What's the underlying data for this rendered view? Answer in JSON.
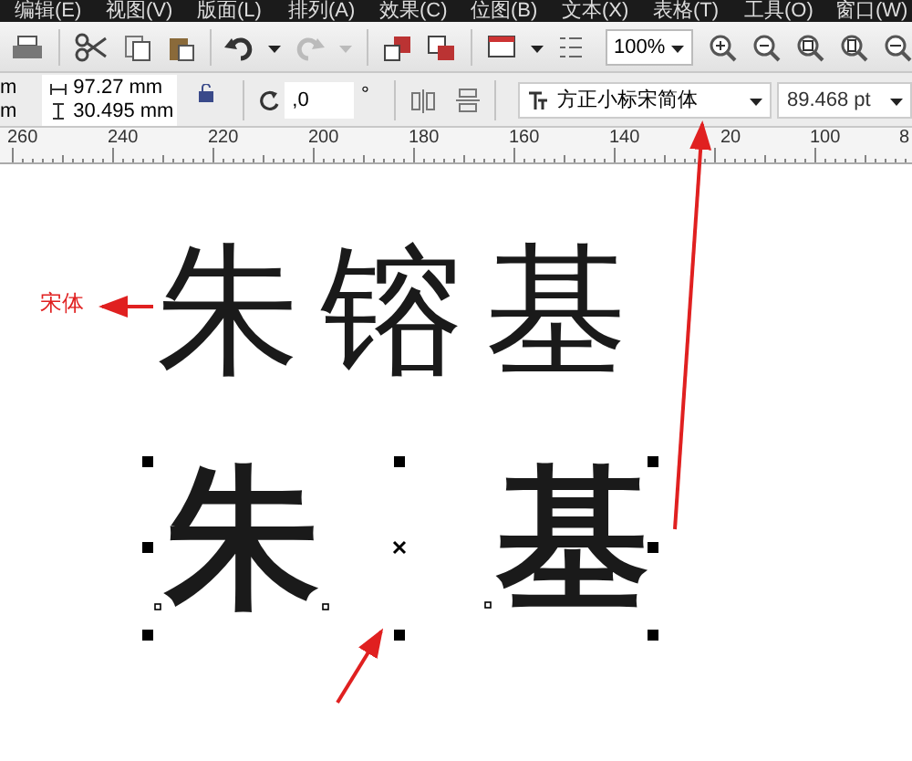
{
  "menu_bar": {
    "items": [
      "编辑(E)",
      "视图(V)",
      "版面(L)",
      "排列(A)",
      "效果(C)",
      "位图(B)",
      "文本(X)",
      "表格(T)",
      "工具(O)",
      "窗口(W)"
    ]
  },
  "toolbar": {
    "zoom": "100%"
  },
  "property_bar": {
    "unit_fragments": [
      "m",
      "m"
    ],
    "width": "97.27 mm",
    "height": "30.495 mm",
    "rotation": ",0",
    "degree": "°",
    "font": "方正小标宋简体",
    "font_size": "89.468 pt"
  },
  "ruler": {
    "labels": [
      "260",
      "240",
      "220",
      "200",
      "180",
      "160",
      "140",
      "20",
      "100",
      "8"
    ]
  },
  "canvas": {
    "annotation": "宋体",
    "text_row_1": "朱镕基",
    "text_row_2": [
      "朱",
      "基"
    ]
  }
}
